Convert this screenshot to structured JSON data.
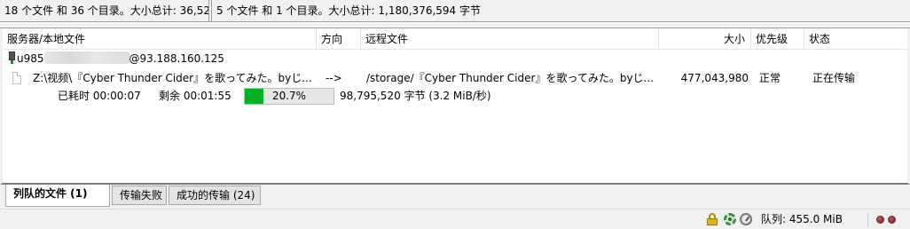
{
  "top_status": {
    "local_summary": "18 个文件 和 36 个目录。大小总计: 36,52",
    "remote_summary": "5 个文件 和 1 个目录。大小总计: 1,180,376,594 字节"
  },
  "queue": {
    "columns": {
      "server_local": "服务器/本地文件",
      "direction": "方向",
      "remote_file": "远程文件",
      "size": "大小",
      "priority": "优先级",
      "status": "状态"
    },
    "server": {
      "user_prefix": "u985",
      "host_suffix": "@93.188.160.125",
      "icon": "server-icon"
    },
    "file": {
      "icon": "file-icon",
      "local_path": "Z:\\视频\\『Cyber Thunder Cider』を歌ってみた。byじ...",
      "direction": "-->",
      "remote_path": "/storage/『Cyber Thunder Cider』を歌ってみた。byじ...",
      "size": "477,043,980",
      "priority": "正常",
      "status": "正在传输"
    },
    "progress": {
      "elapsed": "已耗时 00:00:07",
      "remaining": "剩余 00:01:55",
      "percent_text": "20.7%",
      "percent_value": 20.7,
      "transferred": "98,795,520 字节 (3.2 MiB/秒)",
      "bar_color": "#06b025"
    }
  },
  "tabs": [
    {
      "label": "列队的文件 (1)",
      "active": true
    },
    {
      "label": "传输失败",
      "active": false
    },
    {
      "label": "成功的传输 (24)",
      "active": false
    }
  ],
  "status_bar": {
    "queue_label": "队列: 455.0 MiB",
    "icons": [
      "lock-icon",
      "gear-icon",
      "speed-limit-icon",
      "activity-led-icon"
    ]
  }
}
